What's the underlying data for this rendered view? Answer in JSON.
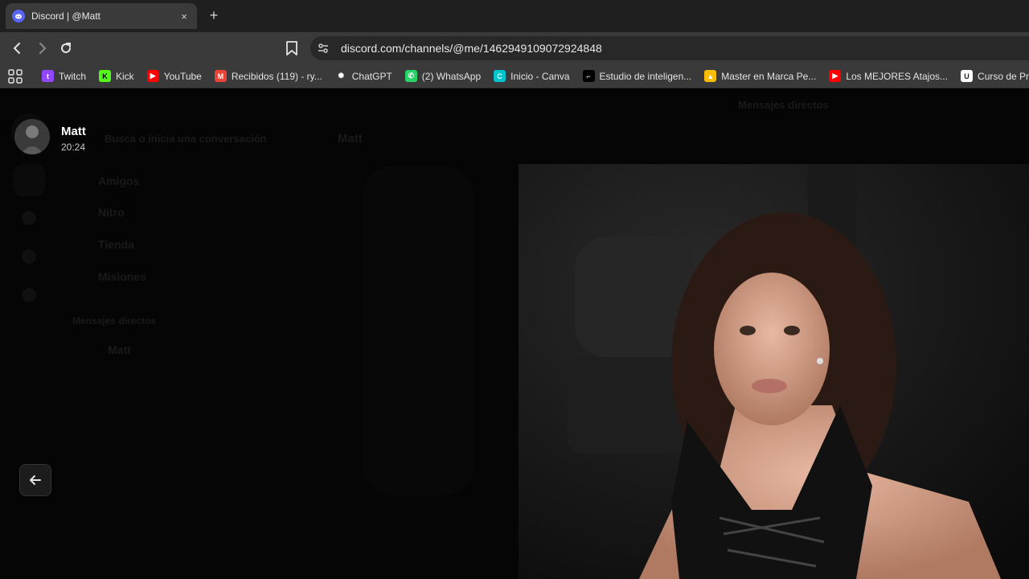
{
  "browser": {
    "tab": {
      "title": "Discord | @Matt",
      "close": "×"
    },
    "new_tab": "+",
    "url": "discord.com/channels/@me/1462949109072924848",
    "bookmarks": [
      {
        "label": "Twitch",
        "icon": "twitch-icon",
        "color": "#9146ff",
        "glyph": "t"
      },
      {
        "label": "Kick",
        "icon": "kick-icon",
        "color": "#53fc18",
        "glyph": "K"
      },
      {
        "label": "YouTube",
        "icon": "youtube-icon",
        "color": "#ff0000",
        "glyph": "▶"
      },
      {
        "label": "Recibidos (119) - ry...",
        "icon": "gmail-icon",
        "color": "#ea4335",
        "glyph": "M"
      },
      {
        "label": "ChatGPT",
        "icon": "chatgpt-icon",
        "color": "#3a3a3a",
        "glyph": "✺"
      },
      {
        "label": "(2) WhatsApp",
        "icon": "whatsapp-icon",
        "color": "#25d366",
        "glyph": "✆"
      },
      {
        "label": "Inicio - Canva",
        "icon": "canva-icon",
        "color": "#00c4cc",
        "glyph": "C"
      },
      {
        "label": "Estudio de inteligen...",
        "icon": "capcut-icon",
        "color": "#000000",
        "glyph": "⌐"
      },
      {
        "label": "Master en Marca Pe...",
        "icon": "google-drive-icon",
        "color": "#fbbc04",
        "glyph": "▲"
      },
      {
        "label": "Los MEJORES Atajos...",
        "icon": "youtube-icon",
        "color": "#ff0000",
        "glyph": "▶"
      },
      {
        "label": "Curso de Pr",
        "icon": "course-icon",
        "color": "#ffffff",
        "glyph": "U"
      }
    ]
  },
  "discord": {
    "dimmed": {
      "top_label": "Mensajes directos",
      "search_placeholder": "Busca o inicia una conversación",
      "channel_name": "Matt",
      "nav_items": [
        "Amigos",
        "Nitro",
        "Tienda",
        "Misiones"
      ],
      "dm_section": "Mensajes directos",
      "dm_item": "Matt"
    },
    "lightbox": {
      "author": "Matt",
      "time": "20:24"
    }
  }
}
